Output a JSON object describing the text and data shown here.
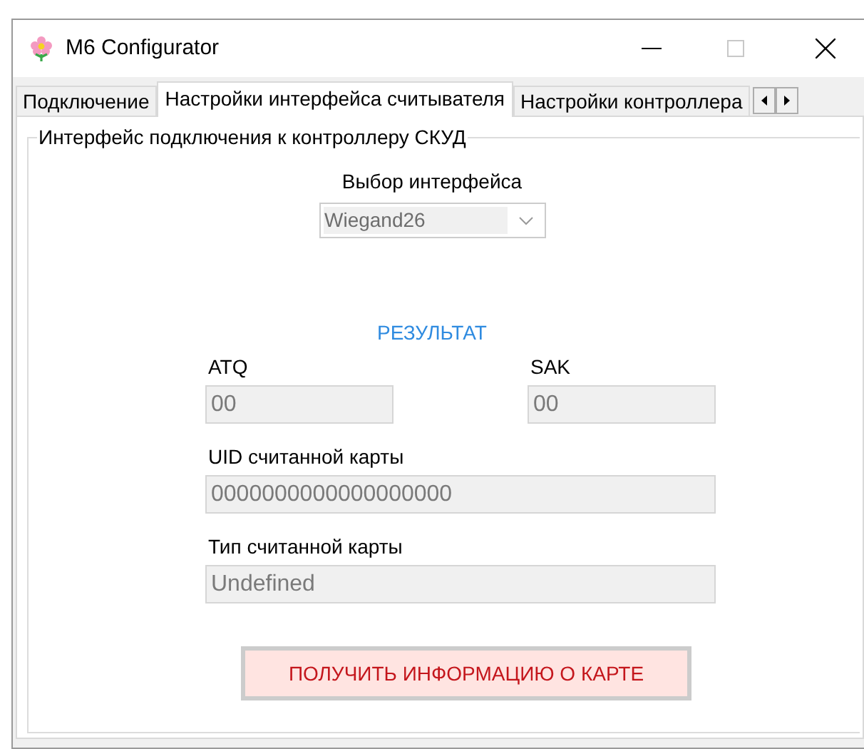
{
  "window": {
    "title": "M6 Configurator"
  },
  "tabs": [
    {
      "label": "Подключение",
      "selected": false
    },
    {
      "label": "Настройки интерфейса считывателя",
      "selected": true
    },
    {
      "label": "Настройки контроллера",
      "selected": false
    }
  ],
  "group": {
    "title": "Интерфейс подключения к контроллеру СКУД"
  },
  "interface": {
    "label": "Выбор интерфейса",
    "value": "Wiegand26",
    "disabled": true
  },
  "result": {
    "heading": "РЕЗУЛЬТАТ"
  },
  "fields": [
    {
      "label": "ATQ",
      "value": "00",
      "disabled": true
    },
    {
      "label": "SAK",
      "value": "00",
      "disabled": true
    },
    {
      "label": "UID считанной карты",
      "value": "0000000000000000000",
      "disabled": true
    },
    {
      "label": "Тип считанной карты",
      "value": "Undefined",
      "disabled": true
    }
  ],
  "button": {
    "label": "ПОЛУЧИТЬ ИНФОРМАЦИЮ О КАРТЕ"
  }
}
